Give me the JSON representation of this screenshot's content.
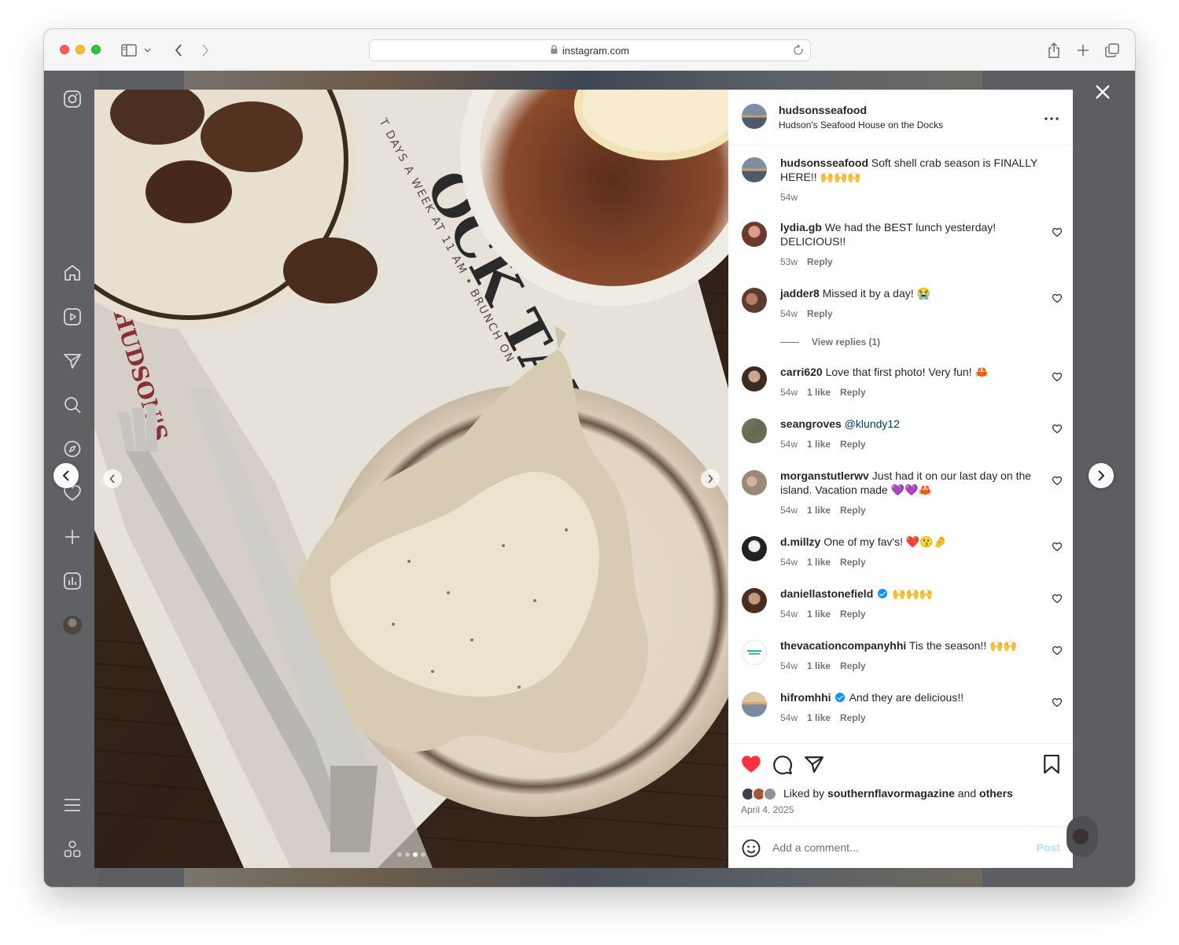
{
  "browser": {
    "url": "instagram.com"
  },
  "post": {
    "username": "hudsonsseafood",
    "location": "Hudson's Seafood House on the Docks",
    "caption_user": "hudsonsseafood",
    "caption_text": "Soft shell crab season is FINALLY HERE!! 🙌🙌🙌",
    "caption_time": "54w",
    "liked_by_prefix": "Liked by",
    "liked_by_user": "southernflavormagazine",
    "liked_by_and": "and",
    "liked_by_others": "others",
    "date": "April 4, 2025",
    "add_comment_placeholder": "Add a comment...",
    "post_label": "Post",
    "media_dots": 4,
    "media_active_dot": 2
  },
  "comments": [
    {
      "user": "lydia.gb",
      "text": "We had the BEST lunch yesterday! DELICIOUS!!",
      "time": "53w",
      "likes": "",
      "reply": "Reply"
    },
    {
      "user": "jadder8",
      "text": "Missed it by a day! 😭",
      "time": "54w",
      "likes": "",
      "reply": "Reply"
    },
    {
      "user": "carri620",
      "text": "Love that first photo! Very fun! 🦀",
      "time": "54w",
      "likes": "1 like",
      "reply": "Reply"
    },
    {
      "user": "seangroves",
      "text": "@klundy12",
      "time": "54w",
      "likes": "1 like",
      "reply": "Reply"
    },
    {
      "user": "morganstutlerwv",
      "text": "Just had it on our last day on the island. Vacation made 💜💜🦀",
      "time": "54w",
      "likes": "1 like",
      "reply": "Reply"
    },
    {
      "user": "d.millzy",
      "text": "One of my fav's! ❤️😗🤌",
      "time": "54w",
      "likes": "1 like",
      "reply": "Reply"
    },
    {
      "user": "daniellastonefield",
      "text": "🙌🙌🙌",
      "time": "54w",
      "likes": "1 like",
      "reply": "Reply"
    },
    {
      "user": "thevacationcompanyhhi",
      "text": "Tis the season!! 🙌🙌",
      "time": "54w",
      "likes": "1 like",
      "reply": "Reply"
    },
    {
      "user": "hifromhhi",
      "text": "And they are delicious!!",
      "time": "54w",
      "likes": "1 like",
      "reply": "Reply"
    }
  ],
  "view_replies": "View replies (1)",
  "colors": {
    "like_red": "#ff3040",
    "link_blue": "#00376b",
    "verified_blue": "#0095f6"
  }
}
